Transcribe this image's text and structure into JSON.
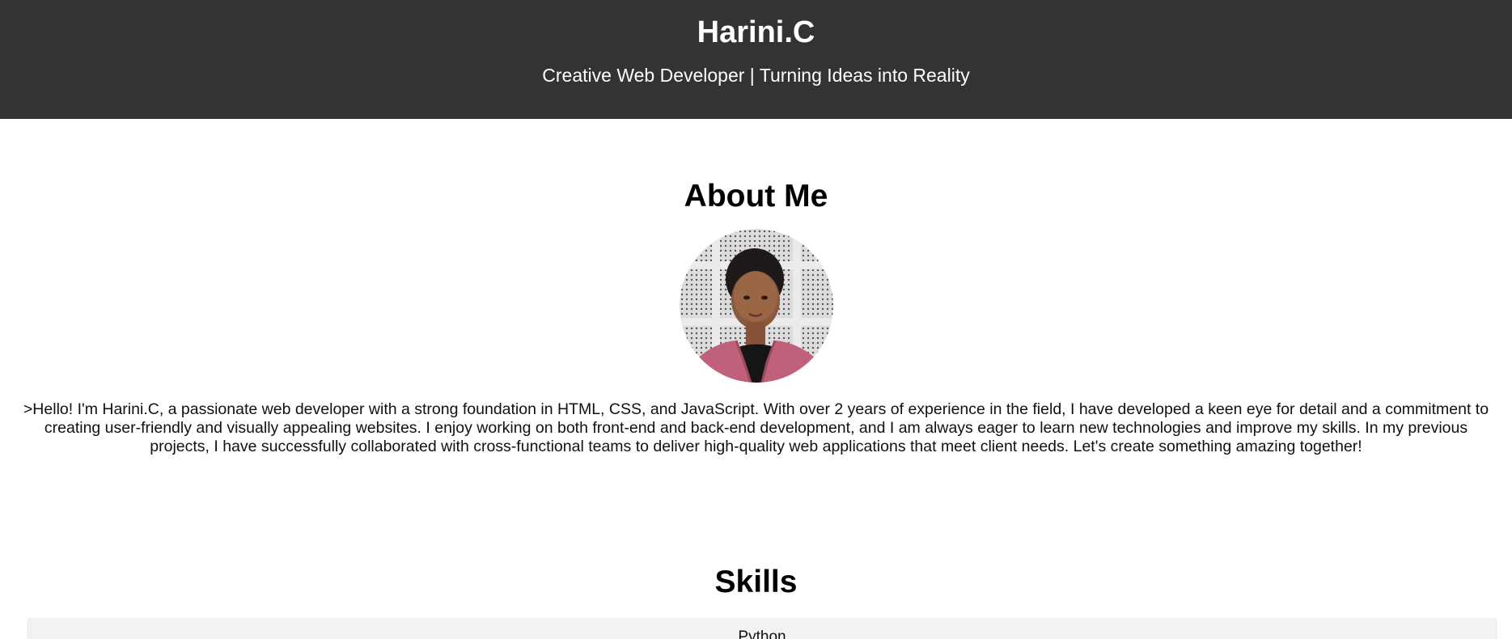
{
  "header": {
    "name": "Harini.C",
    "tagline": "Creative Web Developer | Turning Ideas into Reality"
  },
  "about": {
    "heading": "About Me",
    "paragraph": ">Hello! I'm Harini.C, a passionate web developer with a strong foundation in HTML, CSS, and JavaScript. With over 2 years of experience in the field, I have developed a keen eye for detail and a commitment to creating user-friendly and visually appealing websites. I enjoy working on both front-end and back-end development, and I am always eager to learn new technologies and improve my skills. In my previous projects, I have successfully collaborated with cross-functional teams to deliver high-quality web applications that meet client needs. Let's create something amazing together!"
  },
  "skills": {
    "heading": "Skills",
    "items": [
      "Python"
    ]
  },
  "colors": {
    "header_bg": "#333333",
    "skill_bg": "#f2f2f2"
  }
}
